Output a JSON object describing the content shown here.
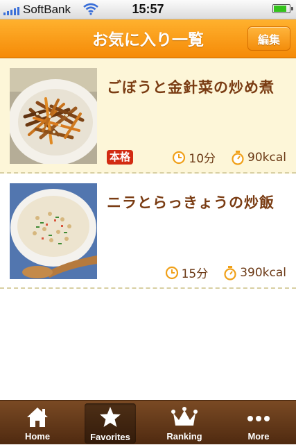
{
  "status": {
    "carrier": "SoftBank",
    "time": "15:57",
    "battery_level": 0.85
  },
  "nav": {
    "title": "お気に入り一覧",
    "edit_label": "編集"
  },
  "recipes": [
    {
      "title": "ごぼうと金針菜の炒め煮",
      "badge": "本格",
      "time": "10分",
      "calories": "90kcal"
    },
    {
      "title": "ニラとらっきょうの炒飯",
      "time": "15分",
      "calories": "390kcal"
    }
  ],
  "tabs": [
    {
      "label": "Home",
      "icon": "home-icon",
      "active": false
    },
    {
      "label": "Favorites",
      "icon": "star-icon",
      "active": true
    },
    {
      "label": "Ranking",
      "icon": "crown-icon",
      "active": false
    },
    {
      "label": "More",
      "icon": "more-dots-icon",
      "active": false
    }
  ],
  "colors": {
    "nav_orange": "#f8980f",
    "title_brown": "#7a3c13",
    "badge_red": "#d22b12",
    "tab_brown": "#5c3315"
  }
}
